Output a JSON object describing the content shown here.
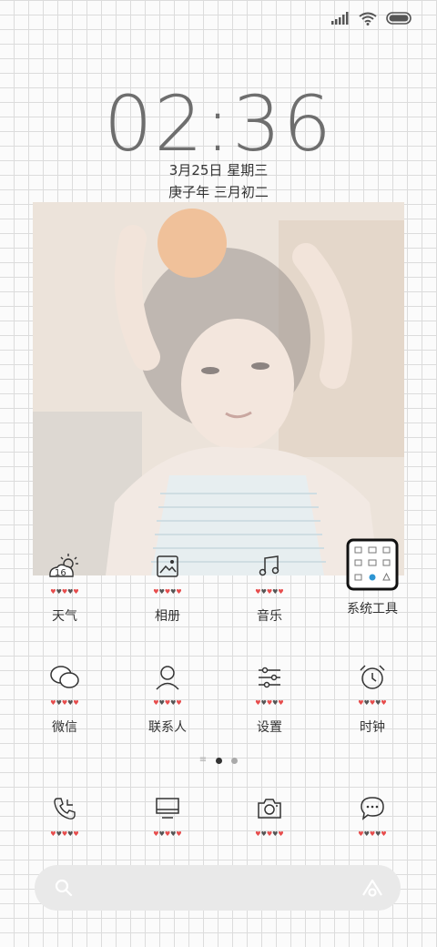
{
  "status_bar": {
    "icons": [
      "signal-icon",
      "wifi-icon",
      "battery-icon"
    ]
  },
  "lockscreen": {
    "time": "02:36",
    "date": "3月25日 星期三",
    "lunar_date": "庚子年 三月初二"
  },
  "widget_icons": {
    "weather_temp": "16"
  },
  "row1": [
    {
      "label": "天气",
      "icon": "weather-icon"
    },
    {
      "label": "相册",
      "icon": "gallery-icon"
    },
    {
      "label": "音乐",
      "icon": "music-icon"
    },
    {
      "label": "系统工具",
      "icon": "system-tools-folder-icon"
    }
  ],
  "row2": [
    {
      "label": "微信",
      "icon": "wechat-icon"
    },
    {
      "label": "联系人",
      "icon": "contacts-icon"
    },
    {
      "label": "设置",
      "icon": "settings-icon"
    },
    {
      "label": "时钟",
      "icon": "clock-icon"
    }
  ],
  "dock": [
    {
      "icon": "phone-icon"
    },
    {
      "icon": "tv-icon"
    },
    {
      "icon": "camera-icon"
    },
    {
      "icon": "messages-icon"
    }
  ],
  "page_indicator": {
    "pages": 3,
    "active": 1
  },
  "colors": {
    "heart": "#e74c4c",
    "grid": "#dcdcdc",
    "text": "#333333"
  }
}
